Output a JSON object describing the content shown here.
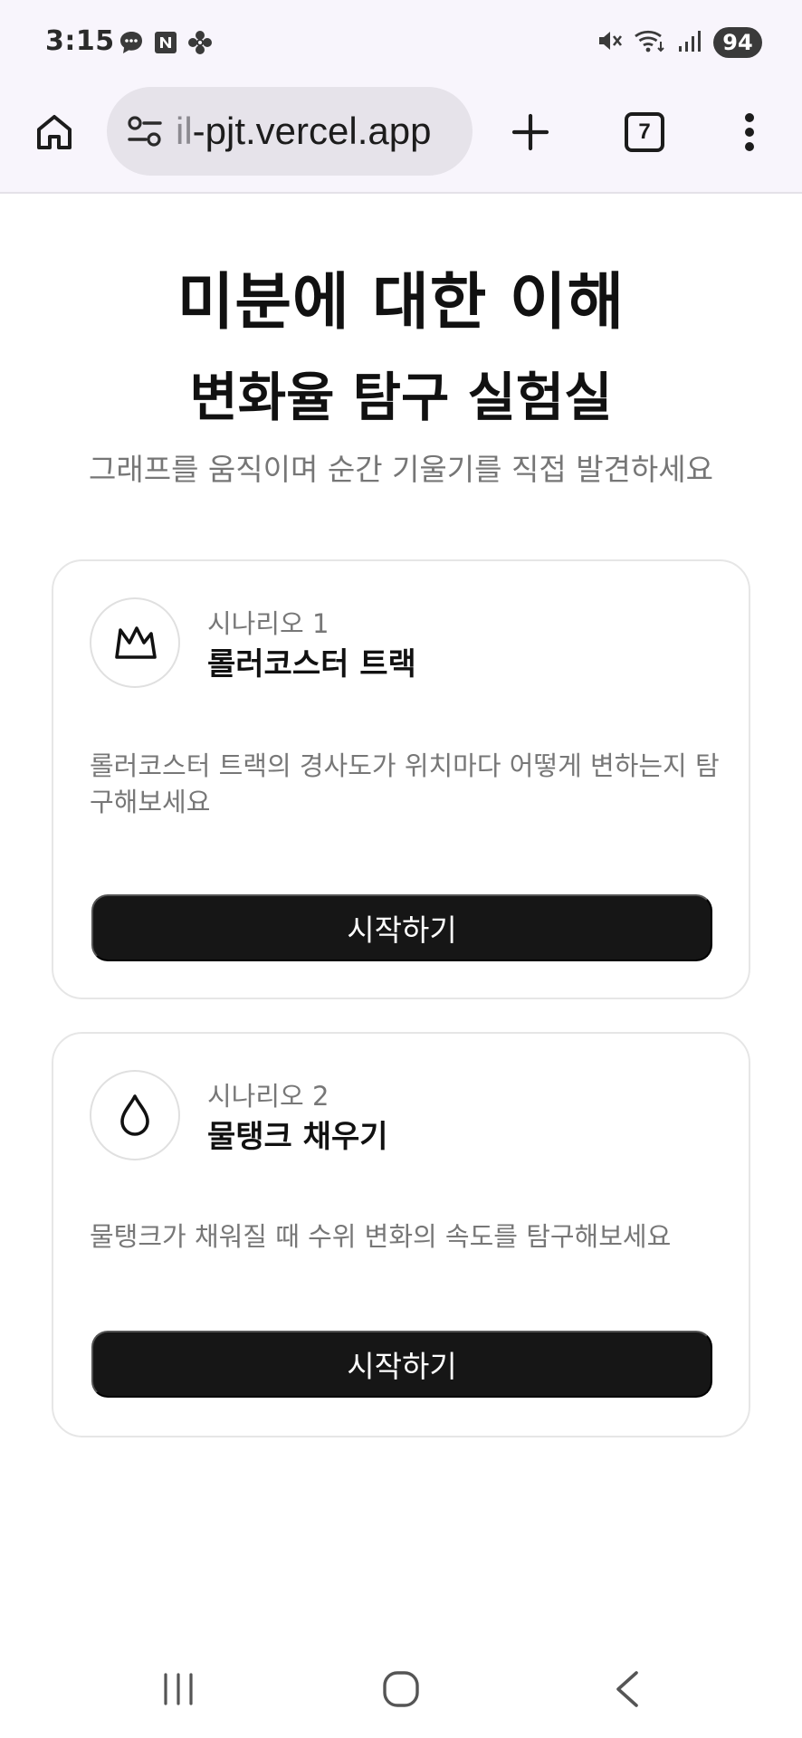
{
  "status_bar": {
    "time": "3:15",
    "left_icons": [
      "chat-bubble-icon",
      "n-app-icon",
      "pinwheel-icon"
    ],
    "right_icons": [
      "mute-icon",
      "wifi-icon",
      "signal-icon"
    ],
    "battery": "94"
  },
  "browser": {
    "url_faded": "il",
    "url_main": "-pjt.vercel.app",
    "tab_count": "7"
  },
  "header": {
    "title": "미분에 대한 이해",
    "subtitle": "변화율 탐구 실험실",
    "tagline": "그래프를 움직이며 순간 기울기를 직접 발견하세요"
  },
  "scenarios": [
    {
      "kicker": "시나리오 1",
      "name": "롤러코스터 트랙",
      "description": "롤러코스터 트랙의 경사도가 위치마다 어떻게 변하는지 탐구해보세요",
      "button": "시작하기",
      "icon": "mountain-icon"
    },
    {
      "kicker": "시나리오 2",
      "name": "물탱크 채우기",
      "description": "물탱크가 채워질 때 수위 변화의 속도를 탐구해보세요",
      "button": "시작하기",
      "icon": "droplet-icon"
    }
  ],
  "colors": {
    "chrome_bg": "#f8f5fc",
    "url_bar_bg": "#e6e3ea",
    "button_bg": "#161616",
    "muted_text": "#777777"
  }
}
